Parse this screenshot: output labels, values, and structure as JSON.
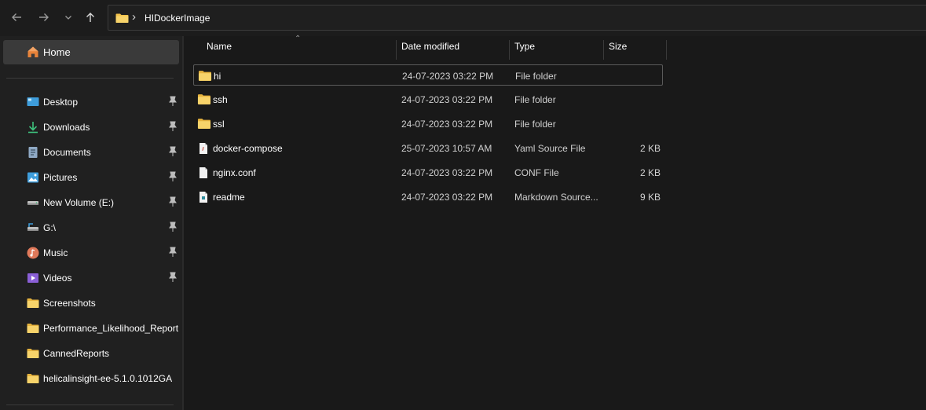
{
  "address_bar": {
    "breadcrumb": "HIDockerImage"
  },
  "sidebar": {
    "home_label": "Home",
    "items": [
      {
        "label": "Desktop",
        "icon": "desktop-icon",
        "pinned": true
      },
      {
        "label": "Downloads",
        "icon": "download-icon",
        "pinned": true
      },
      {
        "label": "Documents",
        "icon": "documents-icon",
        "pinned": true
      },
      {
        "label": "Pictures",
        "icon": "pictures-icon",
        "pinned": true
      },
      {
        "label": "New Volume (E:)",
        "icon": "drive-icon",
        "pinned": true
      },
      {
        "label": "G:\\",
        "icon": "network-drive-icon",
        "pinned": true
      },
      {
        "label": "Music",
        "icon": "music-icon",
        "pinned": true
      },
      {
        "label": "Videos",
        "icon": "videos-icon",
        "pinned": true
      },
      {
        "label": "Screenshots",
        "icon": "folder-icon",
        "pinned": false
      },
      {
        "label": "Performance_Likelihood_Report",
        "icon": "folder-icon",
        "pinned": false
      },
      {
        "label": "CannedReports",
        "icon": "folder-icon",
        "pinned": false
      },
      {
        "label": "helicalinsight-ee-5.1.0.1012GA",
        "icon": "folder-icon",
        "pinned": false
      }
    ]
  },
  "columns": {
    "name": "Name",
    "date": "Date modified",
    "type": "Type",
    "size": "Size"
  },
  "files": [
    {
      "name": "hi",
      "date": "24-07-2023 03:22 PM",
      "type": "File folder",
      "size": "",
      "icon": "folder-icon",
      "selected": true
    },
    {
      "name": "ssh",
      "date": "24-07-2023 03:22 PM",
      "type": "File folder",
      "size": "",
      "icon": "folder-icon"
    },
    {
      "name": "ssl",
      "date": "24-07-2023 03:22 PM",
      "type": "File folder",
      "size": "",
      "icon": "folder-icon"
    },
    {
      "name": "docker-compose",
      "date": "25-07-2023 10:57 AM",
      "type": "Yaml Source File",
      "size": "2 KB",
      "icon": "yaml-file-icon"
    },
    {
      "name": "nginx.conf",
      "date": "24-07-2023 03:22 PM",
      "type": "CONF File",
      "size": "2 KB",
      "icon": "file-icon"
    },
    {
      "name": "readme",
      "date": "24-07-2023 03:22 PM",
      "type": "Markdown Source...",
      "size": "9 KB",
      "icon": "markdown-file-icon"
    }
  ],
  "colors": {
    "folder": "#f0c14b",
    "selected_bg": "#3a3a3a",
    "background": "#191919",
    "sidebar": "#202020"
  }
}
